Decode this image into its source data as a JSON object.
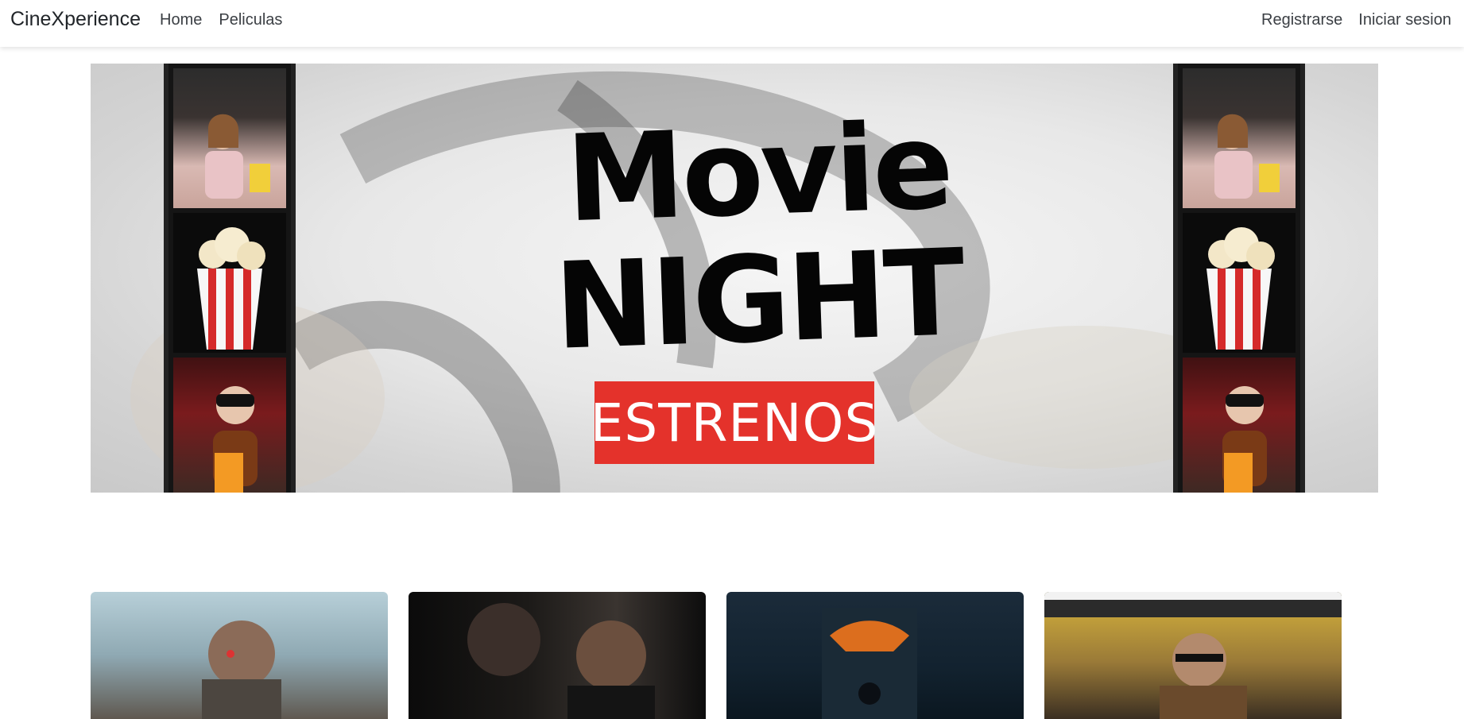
{
  "navbar": {
    "brand": "CineXperience",
    "left_links": [
      "Home",
      "Peliculas"
    ],
    "right_links": [
      "Registrarse",
      "Iniciar sesion"
    ]
  },
  "hero": {
    "title_line1": "Movie",
    "title_line2": "NIGHT",
    "button_label": "ESTRENOS",
    "accent_color": "#e4322b"
  },
  "movies": [
    {
      "image": "terminator-poster"
    },
    {
      "image": "godfather-poster"
    },
    {
      "image": "dark-knight-poster"
    },
    {
      "image": "taxi-driver-poster"
    }
  ]
}
